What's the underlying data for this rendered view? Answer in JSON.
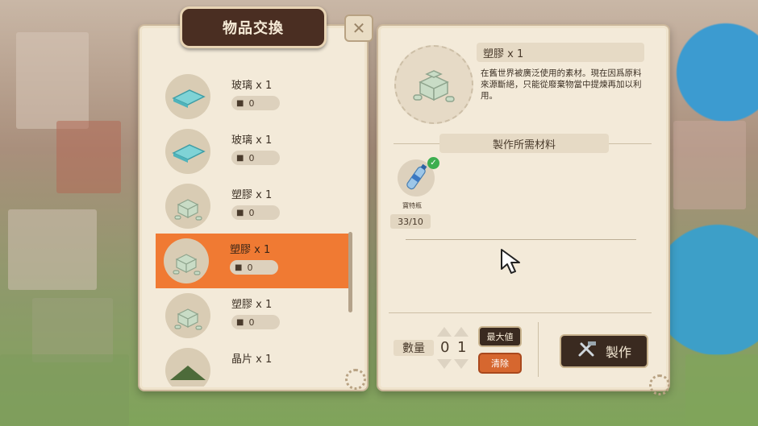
{
  "window": {
    "title": "物品交換",
    "close_icon": "close-icon"
  },
  "list": {
    "items": [
      {
        "name": "玻璃 x 1",
        "count": "0",
        "icon": "glass-icon",
        "selected": false
      },
      {
        "name": "玻璃 x 1",
        "count": "0",
        "icon": "glass-icon",
        "selected": false
      },
      {
        "name": "塑膠 x 1",
        "count": "0",
        "icon": "plastic-icon",
        "selected": false
      },
      {
        "name": "塑膠 x 1",
        "count": "0",
        "icon": "plastic-icon",
        "selected": true
      },
      {
        "name": "塑膠 x 1",
        "count": "0",
        "icon": "plastic-icon",
        "selected": false
      },
      {
        "name": "晶片 x 1",
        "count": "",
        "icon": "chip-icon",
        "selected": false
      }
    ]
  },
  "detail": {
    "title": "塑膠 x 1",
    "description": "在舊世界被廣泛使用的素材。現在因爲原料來源斷絕，只能從廢棄物當中提煉再加以利用。",
    "requirements_title": "製作所需材料",
    "material": {
      "name": "寶特瓶",
      "count": "33/10",
      "icon": "plastic-bottle-icon",
      "satisfied": true
    }
  },
  "quantity": {
    "label": "數量",
    "tens": "0",
    "ones": "1"
  },
  "buttons": {
    "max": "最大値",
    "clear": "清除",
    "craft": "製作"
  },
  "colors": {
    "accent": "#f07a33",
    "dark": "#3a2a20",
    "panel": "#f3ead9"
  }
}
